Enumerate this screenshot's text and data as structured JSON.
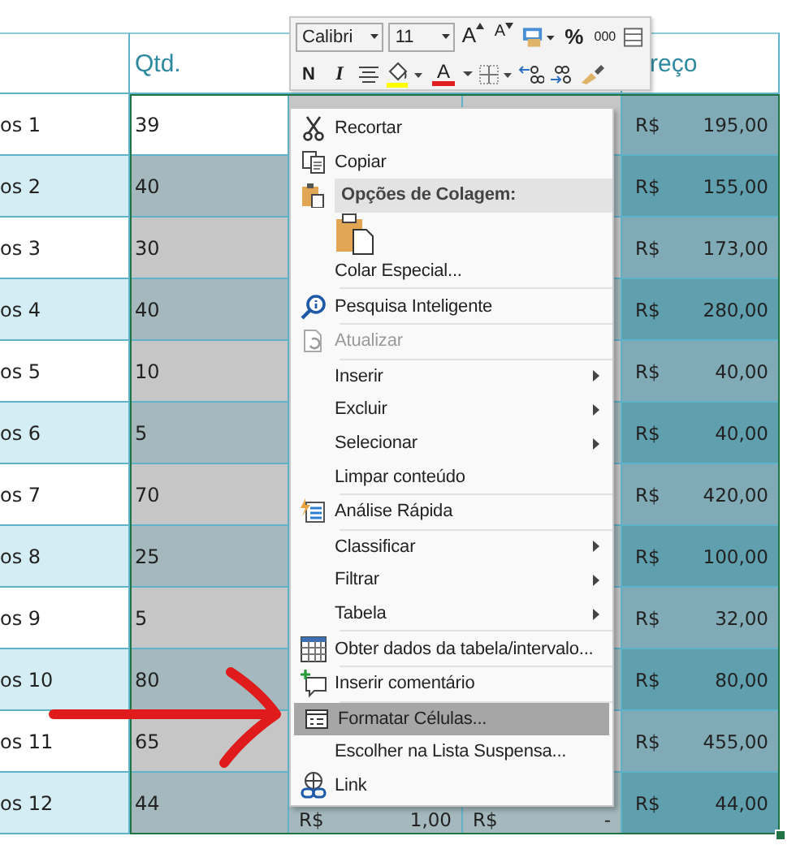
{
  "sheet": {
    "headers": {
      "qty": "Qtd.",
      "price": "reço"
    },
    "rows": [
      {
        "name": "os 1",
        "qty": "39",
        "active": true,
        "currency": "R$",
        "price": "195,00"
      },
      {
        "name": "os 2",
        "qty": "40",
        "active": false,
        "currency": "R$",
        "price": "155,00"
      },
      {
        "name": "os 3",
        "qty": "30",
        "active": false,
        "currency": "R$",
        "price": "173,00"
      },
      {
        "name": "os 4",
        "qty": "40",
        "active": false,
        "currency": "R$",
        "price": "280,00"
      },
      {
        "name": "os 5",
        "qty": "10",
        "active": false,
        "currency": "R$",
        "price": "40,00"
      },
      {
        "name": "os 6",
        "qty": "5",
        "active": false,
        "currency": "R$",
        "price": "40,00"
      },
      {
        "name": "os 7",
        "qty": "70",
        "active": false,
        "currency": "R$",
        "price": "420,00"
      },
      {
        "name": "os 8",
        "qty": "25",
        "active": false,
        "currency": "R$",
        "price": "100,00"
      },
      {
        "name": "os 9",
        "qty": "5",
        "active": false,
        "currency": "R$",
        "price": "32,00"
      },
      {
        "name": "os 10",
        "qty": "80",
        "active": false,
        "currency": "R$",
        "price": "80,00"
      },
      {
        "name": "os 11",
        "qty": "65",
        "active": false,
        "currency": "R$",
        "price": "455,00"
      },
      {
        "name": "os 12",
        "qty": "44",
        "active": false,
        "currency": "R$",
        "price": "44,00",
        "column_c": [
          "R$",
          "1,00"
        ],
        "column_d": [
          "R$",
          "-"
        ]
      }
    ]
  },
  "toolbar": {
    "font": "Calibri",
    "size": "11",
    "grow": "A",
    "shrink": "A",
    "percent": "%",
    "thousands": "000",
    "bold": "N",
    "italic": "I",
    "font_color": "A"
  },
  "menu": [
    {
      "kind": "item",
      "label": "Recortar",
      "disabled": false,
      "highlighted": false,
      "submenu": false
    },
    {
      "kind": "item",
      "label": "Copiar",
      "disabled": false,
      "highlighted": false,
      "submenu": false
    },
    {
      "kind": "header",
      "label": "Opções de Colagem:"
    },
    {
      "kind": "paste"
    },
    {
      "kind": "item",
      "label": "Colar Especial...",
      "disabled": false,
      "highlighted": false,
      "submenu": false
    },
    {
      "kind": "separator"
    },
    {
      "kind": "item",
      "label": "Pesquisa Inteligente",
      "disabled": false,
      "highlighted": false,
      "submenu": false
    },
    {
      "kind": "separator"
    },
    {
      "kind": "item",
      "label": "Atualizar",
      "disabled": true,
      "highlighted": false,
      "submenu": false
    },
    {
      "kind": "separator"
    },
    {
      "kind": "item",
      "label": "Inserir",
      "disabled": false,
      "highlighted": false,
      "submenu": true
    },
    {
      "kind": "item",
      "label": "Excluir",
      "disabled": false,
      "highlighted": false,
      "submenu": true
    },
    {
      "kind": "item",
      "label": "Selecionar",
      "disabled": false,
      "highlighted": false,
      "submenu": true
    },
    {
      "kind": "item",
      "label": "Limpar conteúdo",
      "disabled": false,
      "highlighted": false,
      "submenu": false
    },
    {
      "kind": "separator"
    },
    {
      "kind": "item",
      "label": "Análise Rápida",
      "disabled": false,
      "highlighted": false,
      "submenu": false
    },
    {
      "kind": "separator"
    },
    {
      "kind": "item",
      "label": "Classificar",
      "disabled": false,
      "highlighted": false,
      "submenu": true
    },
    {
      "kind": "item",
      "label": "Filtrar",
      "disabled": false,
      "highlighted": false,
      "submenu": true
    },
    {
      "kind": "item",
      "label": "Tabela",
      "disabled": false,
      "highlighted": false,
      "submenu": true
    },
    {
      "kind": "separator"
    },
    {
      "kind": "item",
      "label": "Obter dados da tabela/intervalo...",
      "disabled": false,
      "highlighted": false,
      "submenu": false
    },
    {
      "kind": "separator"
    },
    {
      "kind": "item",
      "label": "Inserir comentário",
      "disabled": false,
      "highlighted": false,
      "submenu": false
    },
    {
      "kind": "separator"
    },
    {
      "kind": "item",
      "label": "Formatar Células...",
      "disabled": false,
      "highlighted": true,
      "submenu": false
    },
    {
      "kind": "item",
      "label": "Escolher na Lista Suspensa...",
      "disabled": false,
      "highlighted": false,
      "submenu": false
    },
    {
      "kind": "item",
      "label": "Link",
      "disabled": false,
      "highlighted": false,
      "submenu": false
    }
  ]
}
